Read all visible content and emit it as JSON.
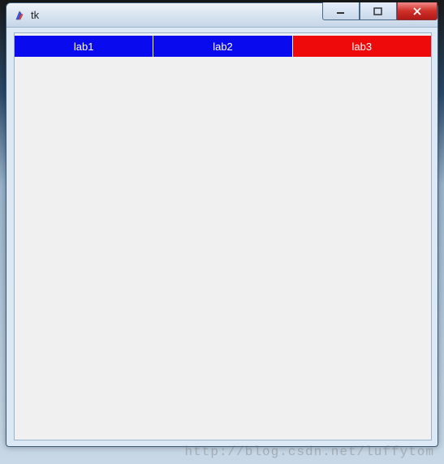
{
  "window": {
    "title": "tk",
    "icon": "feather-icon"
  },
  "labels": [
    {
      "text": "lab1",
      "color": "blue"
    },
    {
      "text": "lab2",
      "color": "blue"
    },
    {
      "text": "lab3",
      "color": "red"
    }
  ],
  "watermark": "http://blog.csdn.net/luffytom"
}
